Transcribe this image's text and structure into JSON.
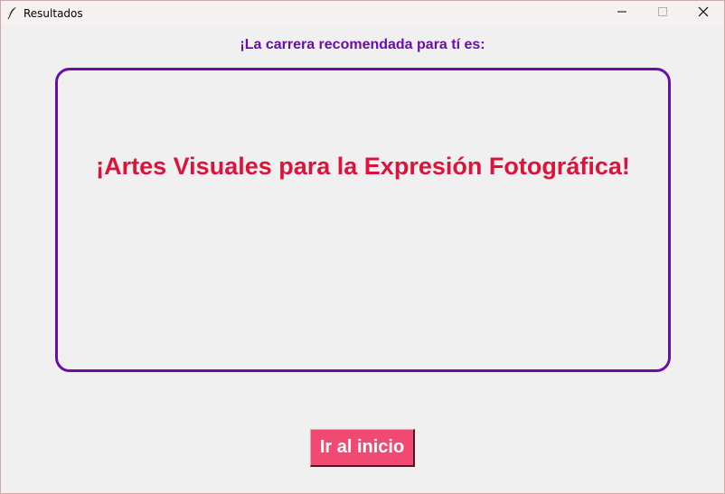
{
  "window": {
    "title": "Resultados",
    "controls": {
      "minimize": "minimize-icon",
      "maximize": "maximize-icon",
      "close": "close-icon"
    }
  },
  "main": {
    "heading": "¡La carrera recomendada para tí es:",
    "result": "¡Artes Visuales para la Expresión Fotográfica!",
    "home_button_label": "Ir al inicio"
  },
  "colors": {
    "accent_purple": "#6a0dad",
    "result_red": "#dc143c",
    "button_pink": "#f04a72",
    "background": "#f0f0f0"
  }
}
